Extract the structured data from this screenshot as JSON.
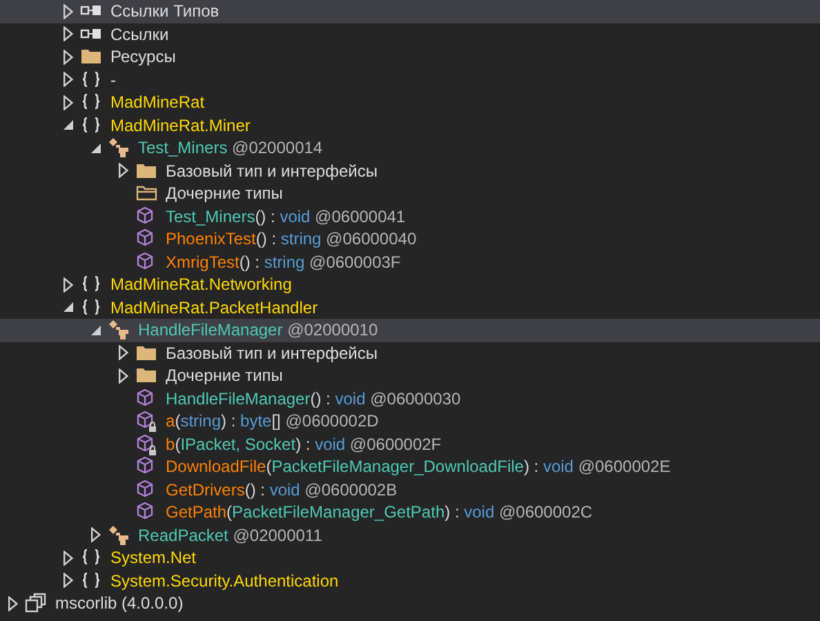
{
  "tree": [
    {
      "kind": "refs",
      "label": [
        {
          "text": "Ссылки Типов",
          "kind": "plain"
        }
      ],
      "expanded": false,
      "selected": true
    },
    {
      "kind": "refs",
      "label": [
        {
          "text": "Ссылки",
          "kind": "plain"
        }
      ],
      "expanded": false,
      "selected": false
    },
    {
      "kind": "folder",
      "label": [
        {
          "text": "Ресурсы",
          "kind": "plain"
        }
      ],
      "expanded": false,
      "selected": false
    },
    {
      "kind": "namespace",
      "label": [
        {
          "text": "-",
          "kind": "plain"
        }
      ],
      "expanded": false,
      "selected": false
    },
    {
      "kind": "namespace",
      "label": [
        {
          "text": "MadMineRat",
          "kind": "namespace"
        }
      ],
      "expanded": false,
      "selected": false
    },
    {
      "kind": "namespace",
      "label": [
        {
          "text": "MadMineRat.Miner",
          "kind": "namespace"
        }
      ],
      "expanded": true,
      "selected": false,
      "children": [
        {
          "kind": "class",
          "label": [
            {
              "text": "Test_Miners",
              "kind": "type"
            },
            {
              "text": " @02000014",
              "kind": "token"
            }
          ],
          "expanded": true,
          "selected": false,
          "children": [
            {
              "kind": "folder",
              "label": [
                {
                  "text": "Базовый тип и интерфейсы",
                  "kind": "plain"
                }
              ],
              "expanded": false,
              "selected": false
            },
            {
              "kind": "folder-empty",
              "label": [
                {
                  "text": "Дочерние типы",
                  "kind": "plain"
                }
              ],
              "selected": false
            },
            {
              "kind": "method",
              "private": false,
              "label": [
                {
                  "text": "Test_Miners",
                  "kind": "type"
                },
                {
                  "text": "() : ",
                  "kind": "punct"
                },
                {
                  "text": "void",
                  "kind": "keyword"
                },
                {
                  "text": " @06000041",
                  "kind": "token"
                }
              ],
              "selected": false
            },
            {
              "kind": "method",
              "private": false,
              "label": [
                {
                  "text": "PhoenixTest",
                  "kind": "method"
                },
                {
                  "text": "() : ",
                  "kind": "punct"
                },
                {
                  "text": "string",
                  "kind": "keyword"
                },
                {
                  "text": " @06000040",
                  "kind": "token"
                }
              ],
              "selected": false
            },
            {
              "kind": "method",
              "private": false,
              "label": [
                {
                  "text": "XmrigTest",
                  "kind": "method"
                },
                {
                  "text": "() : ",
                  "kind": "punct"
                },
                {
                  "text": "string",
                  "kind": "keyword"
                },
                {
                  "text": " @0600003F",
                  "kind": "token"
                }
              ],
              "selected": false
            }
          ]
        }
      ]
    },
    {
      "kind": "namespace",
      "label": [
        {
          "text": "MadMineRat.Networking",
          "kind": "namespace"
        }
      ],
      "expanded": false,
      "selected": false
    },
    {
      "kind": "namespace",
      "label": [
        {
          "text": "MadMineRat.PacketHandler",
          "kind": "namespace"
        }
      ],
      "expanded": true,
      "selected": false,
      "children": [
        {
          "kind": "class",
          "label": [
            {
              "text": "HandleFileManager",
              "kind": "type"
            },
            {
              "text": " @02000010",
              "kind": "token"
            }
          ],
          "expanded": true,
          "selected": true,
          "children": [
            {
              "kind": "folder",
              "label": [
                {
                  "text": "Базовый тип и интерфейсы",
                  "kind": "plain"
                }
              ],
              "expanded": false,
              "selected": false
            },
            {
              "kind": "folder",
              "label": [
                {
                  "text": "Дочерние типы",
                  "kind": "plain"
                }
              ],
              "expanded": false,
              "selected": false
            },
            {
              "kind": "method",
              "private": false,
              "label": [
                {
                  "text": "HandleFileManager",
                  "kind": "type"
                },
                {
                  "text": "() : ",
                  "kind": "punct"
                },
                {
                  "text": "void",
                  "kind": "keyword"
                },
                {
                  "text": " @06000030",
                  "kind": "token"
                }
              ],
              "selected": false
            },
            {
              "kind": "method",
              "private": true,
              "label": [
                {
                  "text": "a",
                  "kind": "method"
                },
                {
                  "text": "(",
                  "kind": "punct"
                },
                {
                  "text": "string",
                  "kind": "keyword"
                },
                {
                  "text": ") : ",
                  "kind": "punct"
                },
                {
                  "text": "byte",
                  "kind": "keyword"
                },
                {
                  "text": "[]",
                  "kind": "punct"
                },
                {
                  "text": " @0600002D",
                  "kind": "token"
                }
              ],
              "selected": false
            },
            {
              "kind": "method",
              "private": true,
              "label": [
                {
                  "text": "b",
                  "kind": "method"
                },
                {
                  "text": "(",
                  "kind": "punct"
                },
                {
                  "text": "IPacket, Socket",
                  "kind": "type"
                },
                {
                  "text": ") : ",
                  "kind": "punct"
                },
                {
                  "text": "void",
                  "kind": "keyword"
                },
                {
                  "text": " @0600002F",
                  "kind": "token"
                }
              ],
              "selected": false
            },
            {
              "kind": "method",
              "private": false,
              "label": [
                {
                  "text": "DownloadFile",
                  "kind": "method"
                },
                {
                  "text": "(",
                  "kind": "punct"
                },
                {
                  "text": "PacketFileManager_DownloadFile",
                  "kind": "type"
                },
                {
                  "text": ") : ",
                  "kind": "punct"
                },
                {
                  "text": "void",
                  "kind": "keyword"
                },
                {
                  "text": " @0600002E",
                  "kind": "token"
                }
              ],
              "selected": false
            },
            {
              "kind": "method",
              "private": false,
              "label": [
                {
                  "text": "GetDrivers",
                  "kind": "method"
                },
                {
                  "text": "() : ",
                  "kind": "punct"
                },
                {
                  "text": "void",
                  "kind": "keyword"
                },
                {
                  "text": " @0600002B",
                  "kind": "token"
                }
              ],
              "selected": false
            },
            {
              "kind": "method",
              "private": false,
              "label": [
                {
                  "text": "GetPath",
                  "kind": "method"
                },
                {
                  "text": "(",
                  "kind": "punct"
                },
                {
                  "text": "PacketFileManager_GetPath",
                  "kind": "type"
                },
                {
                  "text": ") : ",
                  "kind": "punct"
                },
                {
                  "text": "void",
                  "kind": "keyword"
                },
                {
                  "text": " @0600002C",
                  "kind": "token"
                }
              ],
              "selected": false
            }
          ]
        },
        {
          "kind": "class",
          "label": [
            {
              "text": "ReadPacket",
              "kind": "type"
            },
            {
              "text": " @02000011",
              "kind": "token"
            }
          ],
          "expanded": false,
          "selected": false
        }
      ]
    },
    {
      "kind": "namespace",
      "label": [
        {
          "text": "System.Net",
          "kind": "namespace"
        }
      ],
      "expanded": false,
      "selected": false
    },
    {
      "kind": "namespace",
      "label": [
        {
          "text": "System.Security.Authentication",
          "kind": "namespace"
        }
      ],
      "expanded": false,
      "selected": false
    }
  ],
  "assemblies": [
    {
      "kind": "assembly",
      "label": [
        {
          "text": "mscorlib (4.0.0.0)",
          "kind": "plain"
        }
      ],
      "expanded": false,
      "selected": false
    }
  ]
}
